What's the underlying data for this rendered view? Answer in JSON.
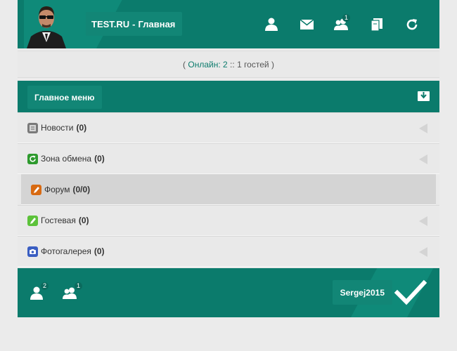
{
  "header": {
    "site": "TEST.RU",
    "separator": "-",
    "page": "Главная",
    "icons": [
      {
        "name": "profile-icon",
        "badge": ""
      },
      {
        "name": "mail-icon",
        "badge": ""
      },
      {
        "name": "friends-icon",
        "badge": "1"
      },
      {
        "name": "book-icon",
        "badge": ""
      },
      {
        "name": "refresh-icon",
        "badge": ""
      }
    ]
  },
  "online": {
    "open": "(",
    "label": "Онлайн: 2",
    "sep": "::",
    "guests": "1 гостей",
    "close": ")"
  },
  "menu": {
    "title": "Главное меню",
    "items": [
      {
        "label": "Новости",
        "count": "(0)",
        "icon": "news-icon",
        "color": "#7a7a7a"
      },
      {
        "label": "Зона обмена",
        "count": "(0)",
        "icon": "exchange-icon",
        "color": "#2e9a2e"
      },
      {
        "label": "Форум",
        "count": "(0/0)",
        "icon": "forum-icon",
        "color": "#d86a12"
      },
      {
        "label": "Гостевая",
        "count": "(0)",
        "icon": "guestbook-icon",
        "color": "#5cc23a"
      },
      {
        "label": "Фотогалерея",
        "count": "(0)",
        "icon": "gallery-icon",
        "color": "#3a5ec2"
      }
    ]
  },
  "footer": {
    "users_badge": "2",
    "friends_badge": "1",
    "username": "Sergej2015"
  },
  "colors": {
    "accent": "#0b7b6c",
    "accent_light": "#128676"
  }
}
